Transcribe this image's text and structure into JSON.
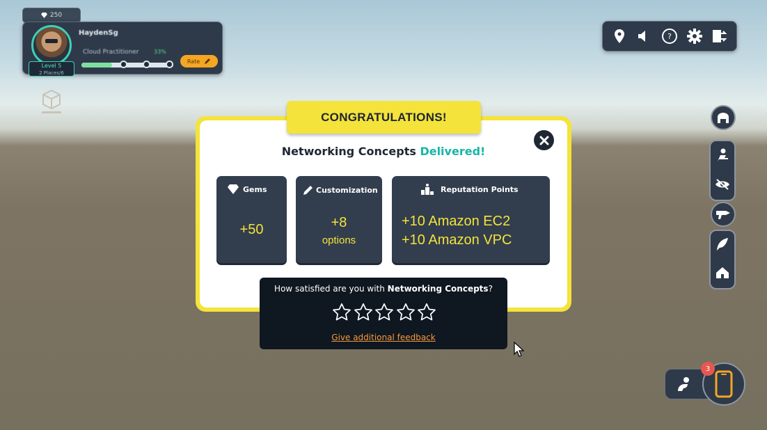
{
  "hud": {
    "gems_top": "250",
    "player": {
      "name": "HaydenSg",
      "role": "Cloud Practitioner",
      "role_progress_label": "33%",
      "role_progress": 0.33,
      "level": "Level 5",
      "level_sub": "2 Places/6",
      "rate_label": "Rate"
    }
  },
  "toolbar": {
    "icons": [
      "map-pin-icon",
      "speaker-icon",
      "help-icon",
      "gear-icon",
      "exit-icon"
    ]
  },
  "modal": {
    "banner": "CONGRATULATIONS!",
    "headline_prefix": "Networking Concepts ",
    "headline_accent": "Delivered!",
    "rewards": {
      "gems": {
        "title": "Gems",
        "value": "+50"
      },
      "customization": {
        "title": "Customization",
        "value": "+8",
        "unit": "options"
      },
      "reputation": {
        "title": "Reputation Points",
        "lines": [
          "+10 Amazon EC2",
          "+10 Amazon VPC"
        ]
      }
    }
  },
  "feedback": {
    "question_prefix": "How satisfied are you with ",
    "question_subject": "Networking Concepts",
    "question_suffix": "?",
    "rating": 0,
    "max_rating": 5,
    "link": "Give additional feedback"
  },
  "notifications": {
    "count": "3"
  },
  "colors": {
    "accent_yellow": "#f4e33a",
    "teal": "#18b6a7",
    "panel_dark": "#323e4e",
    "link_orange": "#f39a3c"
  }
}
